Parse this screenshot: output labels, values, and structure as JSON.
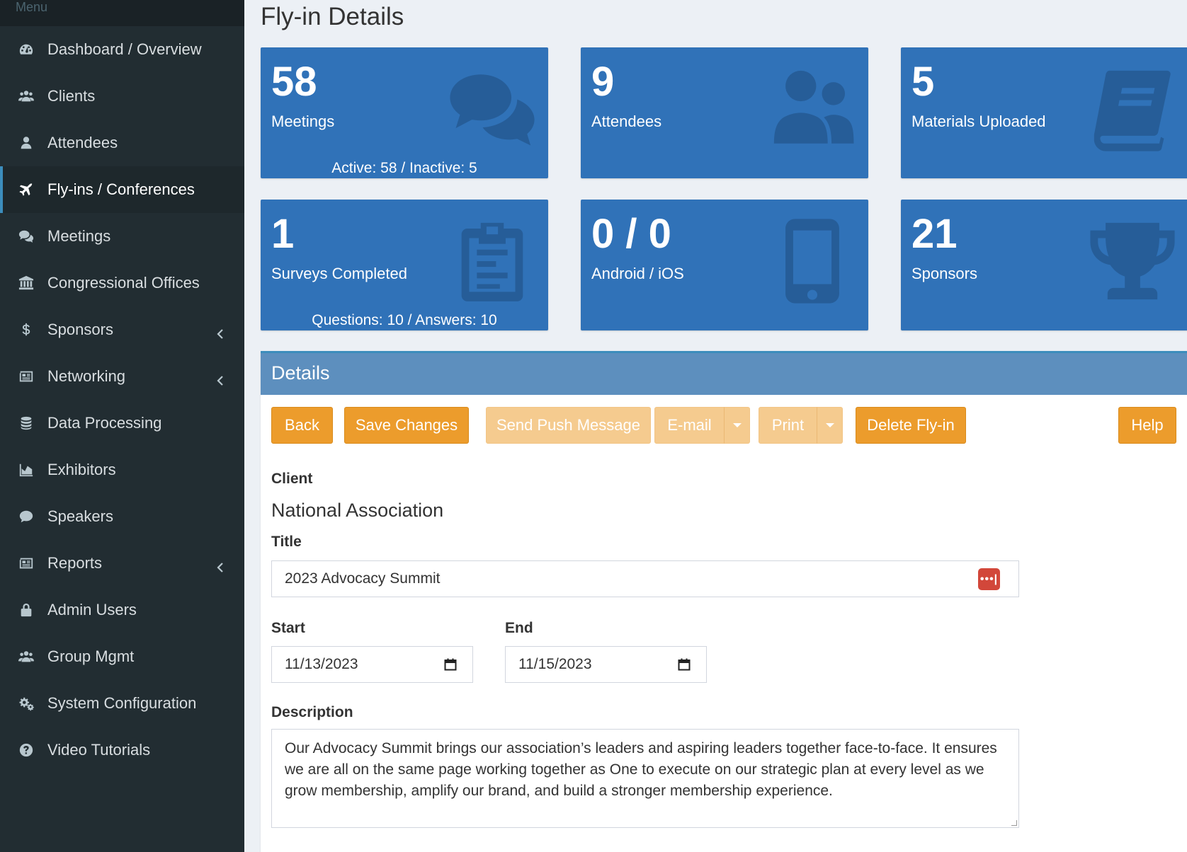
{
  "sidebar": {
    "header": "Menu",
    "items": [
      {
        "label": "Dashboard / Overview",
        "icon": "dashboard-icon"
      },
      {
        "label": "Clients",
        "icon": "users-icon"
      },
      {
        "label": "Attendees",
        "icon": "user-icon"
      },
      {
        "label": "Fly-ins / Conferences",
        "icon": "plane-icon",
        "active": true
      },
      {
        "label": "Meetings",
        "icon": "comments-icon"
      },
      {
        "label": "Congressional Offices",
        "icon": "bank-icon"
      },
      {
        "label": "Sponsors",
        "icon": "dollar-icon",
        "has_submenu": true
      },
      {
        "label": "Networking",
        "icon": "newspaper-icon",
        "has_submenu": true
      },
      {
        "label": "Data Processing",
        "icon": "database-icon"
      },
      {
        "label": "Exhibitors",
        "icon": "area-chart-icon"
      },
      {
        "label": "Speakers",
        "icon": "comment-icon"
      },
      {
        "label": "Reports",
        "icon": "newspaper-icon",
        "has_submenu": true
      },
      {
        "label": "Admin Users",
        "icon": "lock-icon"
      },
      {
        "label": "Group Mgmt",
        "icon": "users-icon"
      },
      {
        "label": "System Configuration",
        "icon": "gears-icon"
      },
      {
        "label": "Video Tutorials",
        "icon": "question-circle-icon"
      }
    ]
  },
  "page": {
    "title": "Fly-in Details"
  },
  "tiles": [
    {
      "value": "58",
      "label": "Meetings",
      "footer": "Active: 58 / Inactive: 5",
      "icon": "comments-icon"
    },
    {
      "value": "9",
      "label": "Attendees",
      "footer": "",
      "icon": "users-icon"
    },
    {
      "value": "5",
      "label": "Materials Uploaded",
      "footer": "",
      "icon": "book-icon"
    },
    {
      "value": "1",
      "label": "Surveys Completed",
      "footer": "Questions: 10 / Answers: 10",
      "icon": "clipboard-icon"
    },
    {
      "value": "0 / 0",
      "label": "Android / iOS",
      "footer": "",
      "icon": "mobile-icon"
    },
    {
      "value": "21",
      "label": "Sponsors",
      "footer": "",
      "icon": "trophy-icon"
    }
  ],
  "details": {
    "header": "Details",
    "buttons": {
      "back": "Back",
      "save": "Save Changes",
      "push": "Send Push Message",
      "email": "E-mail",
      "print": "Print",
      "delete": "Delete Fly-in",
      "help": "Help"
    },
    "client_label": "Client",
    "client_value": "National Association",
    "title_label": "Title",
    "title_value": "2023 Advocacy Summit",
    "start_label": "Start",
    "start_value": "11/13/2023",
    "end_label": "End",
    "end_value": "11/15/2023",
    "description_label": "Description",
    "description_value": "Our Advocacy Summit brings our association’s leaders and aspiring leaders together face-to-face. It ensures we are all on the same page working together as One to execute on our strategic plan at every level as we grow membership, amplify our brand, and build a stronger membership experience."
  },
  "colors": {
    "sidebar_bg": "#222d32",
    "tile_bg": "#3072b8",
    "box_header": "#5d8fbe",
    "button_orange": "#ec9c2c",
    "button_disabled": "#f5cb8f",
    "accent": "#3c8dbc"
  }
}
